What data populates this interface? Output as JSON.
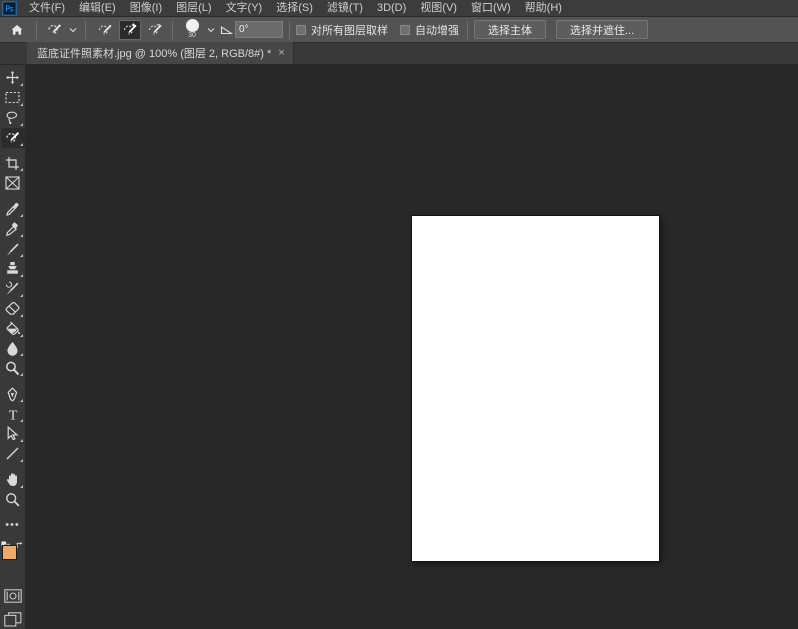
{
  "app": {
    "icon_name": "photoshop-app-icon",
    "title": "Adobe Photoshop"
  },
  "menubar": {
    "items": [
      {
        "label": "文件(F)",
        "name": "menu-file"
      },
      {
        "label": "编辑(E)",
        "name": "menu-edit"
      },
      {
        "label": "图像(I)",
        "name": "menu-image"
      },
      {
        "label": "图层(L)",
        "name": "menu-layer"
      },
      {
        "label": "文字(Y)",
        "name": "menu-type"
      },
      {
        "label": "选择(S)",
        "name": "menu-select"
      },
      {
        "label": "滤镜(T)",
        "name": "menu-filter"
      },
      {
        "label": "3D(D)",
        "name": "menu-3d"
      },
      {
        "label": "视图(V)",
        "name": "menu-view"
      },
      {
        "label": "窗口(W)",
        "name": "menu-window"
      },
      {
        "label": "帮助(H)",
        "name": "menu-help"
      }
    ]
  },
  "optionsbar": {
    "home_icon": "home-icon",
    "tool_preset_icon": "quick-selection-tool-icon",
    "preset_chevron": "chevron-down-icon",
    "modes": [
      {
        "name": "new-selection-mode",
        "icon": "quick-selection-new-icon",
        "active": false
      },
      {
        "name": "add-to-selection-mode",
        "icon": "quick-selection-add-icon",
        "active": true
      },
      {
        "name": "subtract-from-selection-mode",
        "icon": "quick-selection-subtract-icon",
        "active": false
      }
    ],
    "brush": {
      "size_label": "30",
      "picker_chevron": "chevron-down-icon"
    },
    "angle": {
      "icon": "angle-icon",
      "value": "0°"
    },
    "checkboxes": [
      {
        "label": "对所有图层取样",
        "name": "sample-all-layers-checkbox",
        "checked": false
      },
      {
        "label": "自动增强",
        "name": "auto-enhance-checkbox",
        "checked": false
      }
    ],
    "buttons": [
      {
        "label": "选择主体",
        "name": "select-subject-button"
      },
      {
        "label": "选择并遮住...",
        "name": "select-and-mask-button"
      }
    ]
  },
  "tabbar": {
    "tabs": [
      {
        "label": "蓝底证件照素材.jpg @ 100% (图层 2, RGB/8#) *",
        "name": "document-tab",
        "close_glyph": "×",
        "active": true
      }
    ]
  },
  "toolbar": {
    "tools": [
      {
        "name": "move-tool",
        "icon": "move-icon",
        "selected": false,
        "has_flyout": true
      },
      {
        "name": "rectangular-marquee-tool",
        "icon": "marquee-icon",
        "selected": false,
        "has_flyout": true
      },
      {
        "name": "lasso-tool",
        "icon": "lasso-icon",
        "selected": false,
        "has_flyout": true
      },
      {
        "name": "quick-selection-tool",
        "icon": "quick-selection-icon",
        "selected": true,
        "has_flyout": true
      },
      {
        "name": "crop-tool",
        "icon": "crop-icon",
        "selected": false,
        "has_flyout": true
      },
      {
        "name": "frame-tool",
        "icon": "frame-icon",
        "selected": false,
        "has_flyout": false
      },
      {
        "name": "eyedropper-tool",
        "icon": "eyedropper-icon",
        "selected": false,
        "has_flyout": true
      },
      {
        "name": "spot-healing-brush-tool",
        "icon": "healing-brush-icon",
        "selected": false,
        "has_flyout": true
      },
      {
        "name": "brush-tool",
        "icon": "brush-icon",
        "selected": false,
        "has_flyout": true
      },
      {
        "name": "clone-stamp-tool",
        "icon": "clone-stamp-icon",
        "selected": false,
        "has_flyout": true
      },
      {
        "name": "history-brush-tool",
        "icon": "history-brush-icon",
        "selected": false,
        "has_flyout": true
      },
      {
        "name": "eraser-tool",
        "icon": "eraser-icon",
        "selected": false,
        "has_flyout": true
      },
      {
        "name": "gradient-tool",
        "icon": "paint-bucket-icon",
        "selected": false,
        "has_flyout": true
      },
      {
        "name": "blur-tool",
        "icon": "blur-droplet-icon",
        "selected": false,
        "has_flyout": true
      },
      {
        "name": "dodge-tool",
        "icon": "dodge-icon",
        "selected": false,
        "has_flyout": true
      },
      {
        "name": "pen-tool",
        "icon": "pen-icon",
        "selected": false,
        "has_flyout": true
      },
      {
        "name": "type-tool",
        "icon": "type-t-icon",
        "selected": false,
        "has_flyout": true
      },
      {
        "name": "path-selection-tool",
        "icon": "path-arrow-icon",
        "selected": false,
        "has_flyout": true
      },
      {
        "name": "line-tool",
        "icon": "line-icon",
        "selected": false,
        "has_flyout": true
      },
      {
        "name": "hand-tool",
        "icon": "hand-icon",
        "selected": false,
        "has_flyout": true
      },
      {
        "name": "zoom-tool",
        "icon": "magnifier-icon",
        "selected": false,
        "has_flyout": false
      }
    ],
    "more_tools": {
      "name": "edit-toolbar-button",
      "glyph": "•••"
    },
    "colors": {
      "foreground": "#f0a868",
      "background": "#ffffff",
      "default_colors_name": "default-colors-icon",
      "swap_colors_name": "swap-colors-icon"
    },
    "quick_mask": {
      "name": "quick-mask-mode-button",
      "icon": "quick-mask-icon"
    },
    "screen_mode": {
      "name": "screen-mode-button",
      "icon": "screen-mode-icon"
    }
  },
  "canvas": {
    "name": "document-canvas",
    "background": "#ffffff",
    "workspace_background": "#282828",
    "zoom": "100%"
  }
}
